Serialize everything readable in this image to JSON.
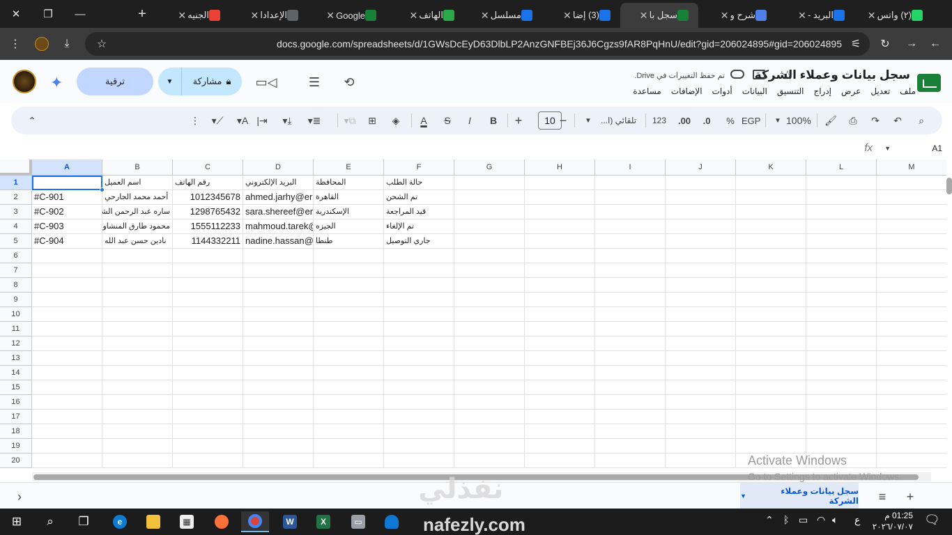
{
  "browser": {
    "tabs": [
      {
        "title": "(٢) واتس",
        "icon": "whatsapp-icon",
        "color": "#25d366"
      },
      {
        "title": "البريد -",
        "icon": "mail-icon",
        "color": "#1a73e8"
      },
      {
        "title": "شرح و",
        "icon": "gemini-icon",
        "color": "#4f7fe8"
      },
      {
        "title": "سجل با",
        "icon": "sheets-icon",
        "color": "#188038",
        "active": true
      },
      {
        "title": "(3) إضا",
        "icon": "app-icon",
        "color": "#1a73e8"
      },
      {
        "title": "مسلسل",
        "icon": "play-icon",
        "color": "#1a73e8"
      },
      {
        "title": "الهاتف",
        "icon": "k-icon",
        "color": "#2ba84a"
      },
      {
        "title": "Google",
        "icon": "sheets-icon",
        "color": "#188038"
      },
      {
        "title": "الإعدادا",
        "icon": "gear-icon",
        "color": "#5f6368"
      },
      {
        "title": "الجنيه",
        "icon": "google-icon",
        "color": "#ea4335"
      }
    ],
    "url": "docs.google.com/spreadsheets/d/1GWsDcEyD63DlbLP2AnzGNFBEj36J6Cgzs9fAR8PqHnU/edit?gid=206024895#gid=206024895"
  },
  "doc": {
    "title": "سجل بيانات وعملاء الشركة",
    "saved_status": "تم حفظ التغييرات في Drive.",
    "menu": [
      "ملف",
      "تعديل",
      "عرض",
      "إدراج",
      "التنسيق",
      "البيانات",
      "أدوات",
      "الإضافات",
      "مساعدة"
    ],
    "share_label": "مشاركة",
    "upgrade_label": "ترقية"
  },
  "toolbar": {
    "zoom": "100%",
    "currency": "EGP",
    "percent": "%",
    "dec_decrease": ".0",
    ".00": ".00",
    "format_123": "123",
    "font": "تلقائي (ا...",
    "font_size": "10",
    "bold": "B",
    "italic": "I",
    "strike": "S",
    "text_color": "A"
  },
  "formula_bar": {
    "name_box": "A1",
    "fx": "fx"
  },
  "grid": {
    "columns": [
      "A",
      "B",
      "C",
      "D",
      "E",
      "F",
      "G",
      "H",
      "I",
      "J",
      "K",
      "L",
      "M"
    ],
    "rows": [
      "1",
      "2",
      "3",
      "4",
      "5",
      "6",
      "7",
      "8",
      "9",
      "10",
      "11",
      "12",
      "13",
      "14",
      "15",
      "16",
      "17",
      "18",
      "19",
      "20"
    ],
    "headers": {
      "B": "اسم العميل",
      "C": "رقم الهاتف",
      "D": "البريد الإلكتروني",
      "E": "المحافظة",
      "F": "حالة الطلب"
    },
    "records": [
      {
        "A": "#C-901",
        "B": "أحمد محمد الجارحي",
        "C": "1012345678",
        "D": "ahmed.jarhy@er",
        "E": "القاهرة",
        "F": "تم الشحن"
      },
      {
        "A": "#C-902",
        "B": "ساره عبد الرحمن الشر",
        "C": "1298765432",
        "D": "sara.shereef@er",
        "E": "الإسكندرية",
        "F": "قيد المراجعة"
      },
      {
        "A": "#C-903",
        "B": "محمود طارق المنشاوي",
        "C": "1555112233",
        "D": "mahmoud.tarek@",
        "E": "الجيزه",
        "F": "تم الإلغاء"
      },
      {
        "A": "#C-904",
        "B": "نادين حسن عبد الله",
        "C": "1144332211",
        "D": "nadine.hassan@",
        "E": "طنطا",
        "F": "جاري التوصيل"
      }
    ]
  },
  "sheet_tabs": {
    "active": "سجل بيانات وعملاء الشركة"
  },
  "overlay": {
    "activate_title": "Activate Windows",
    "activate_sub": "Go to Settings to activate Windows.",
    "watermark": "نفذلي",
    "watermark_url": "nafezly.com"
  },
  "taskbar": {
    "time": "01:25 م",
    "date": "٢٠٢٦/٠٧/٠٧",
    "lang": "ع"
  }
}
